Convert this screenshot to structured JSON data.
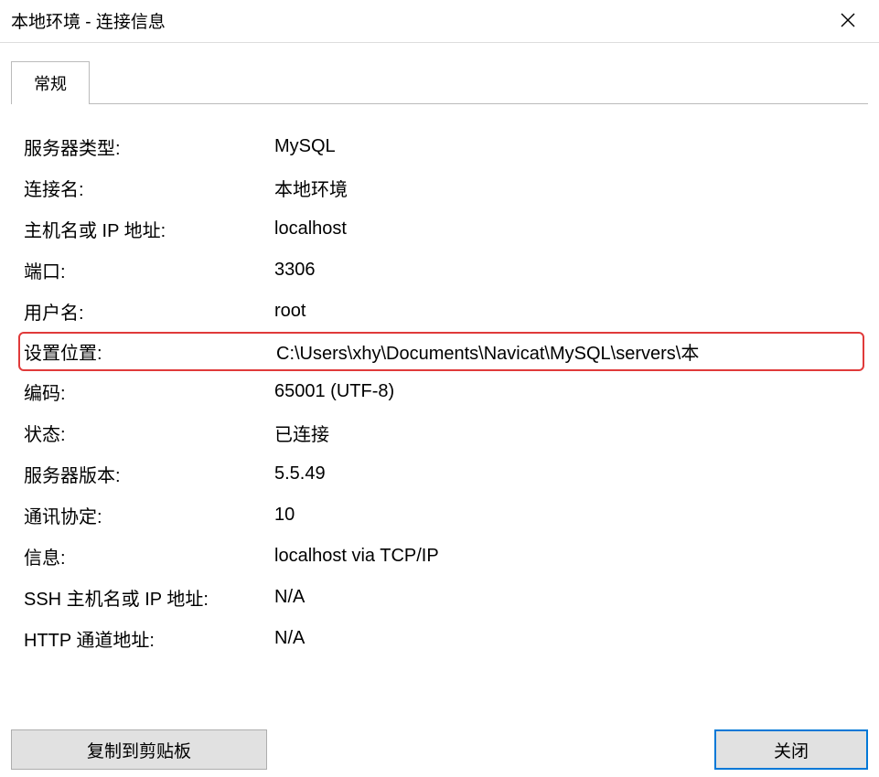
{
  "title": "本地环境 - 连接信息",
  "tab": {
    "label": "常规"
  },
  "rows": [
    {
      "label": "服务器类型:",
      "value": "MySQL"
    },
    {
      "label": "连接名:",
      "value": "本地环境"
    },
    {
      "label": "主机名或 IP 地址:",
      "value": "localhost"
    },
    {
      "label": "端口:",
      "value": "3306"
    },
    {
      "label": "用户名:",
      "value": "root"
    },
    {
      "label": "设置位置:",
      "value": "C:\\Users\\xhy\\Documents\\Navicat\\MySQL\\servers\\本"
    },
    {
      "label": "编码:",
      "value": "65001 (UTF-8)"
    },
    {
      "label": "状态:",
      "value": "已连接"
    },
    {
      "label": "服务器版本:",
      "value": "5.5.49"
    },
    {
      "label": "通讯协定:",
      "value": "10"
    },
    {
      "label": "信息:",
      "value": "localhost via TCP/IP"
    },
    {
      "label": "SSH 主机名或 IP 地址:",
      "value": "N/A"
    },
    {
      "label": "HTTP 通道地址:",
      "value": "N/A"
    }
  ],
  "buttons": {
    "copy": "复制到剪贴板",
    "close": "关闭"
  }
}
